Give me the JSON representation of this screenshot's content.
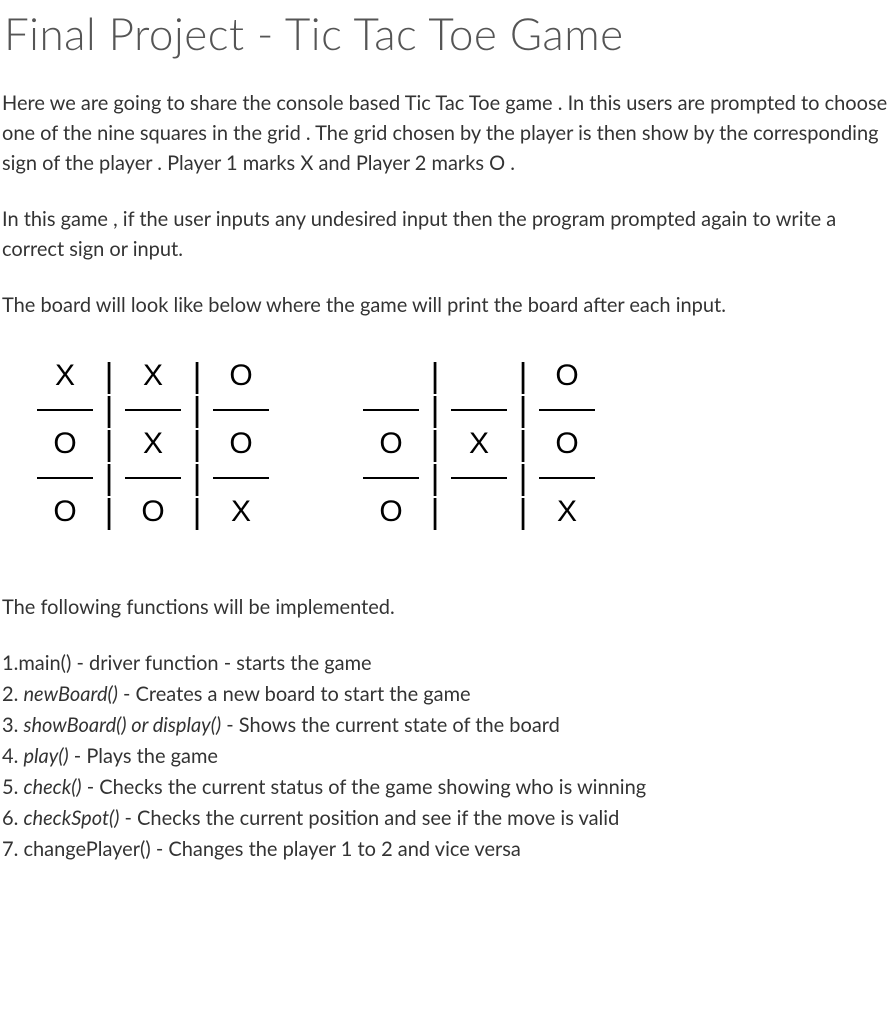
{
  "title": "Final Project - Tic Tac Toe Game",
  "para1": "Here we are going  to share the  console based Tic Tac Toe game . In this users are prompted to choose one of the nine squares in the grid . The grid chosen by the player is then show by the corresponding sign of the player . Player 1 marks X  and Player 2 marks O  .",
  "para2": "In this game , if the user inputs any undesired input then the program prompted  again to write a correct sign or input.",
  "para3": "The board will look like below where the game will print the board after each input.",
  "boards": [
    {
      "rows": [
        [
          "X",
          "X",
          "O"
        ],
        [
          "O",
          "X",
          "O"
        ],
        [
          "O",
          "O",
          "X"
        ]
      ]
    },
    {
      "rows": [
        [
          "",
          "",
          "O"
        ],
        [
          "O",
          "X",
          "O"
        ],
        [
          "O",
          "",
          "X"
        ]
      ]
    }
  ],
  "para4": "The following functions will be implemented.",
  "functions": [
    {
      "num": "1.",
      "name": "main()",
      "desc": " - driver function - starts the game",
      "italic": false
    },
    {
      "num": "2. ",
      "name": "newBoard()",
      "desc": " - Creates a new board to start the game",
      "italic": true
    },
    {
      "num": "3. ",
      "name": "showBoard() or display()",
      "desc": " - Shows the current state of the board",
      "italic": true
    },
    {
      "num": "4. ",
      "name": "play()",
      "desc": " - Plays the game",
      "italic": true
    },
    {
      "num": "5. ",
      "name": "check()",
      "desc": " - Checks the current status of the game showing who is winning",
      "italic": true
    },
    {
      "num": "6. ",
      "name": "checkSpot()",
      "desc": " - Checks the current position and see if the move is valid",
      "italic": true
    },
    {
      "num": "7. ",
      "name": "changePlayer()",
      "desc": " - Changes the player 1 to 2 and vice versa",
      "italic": false
    }
  ]
}
